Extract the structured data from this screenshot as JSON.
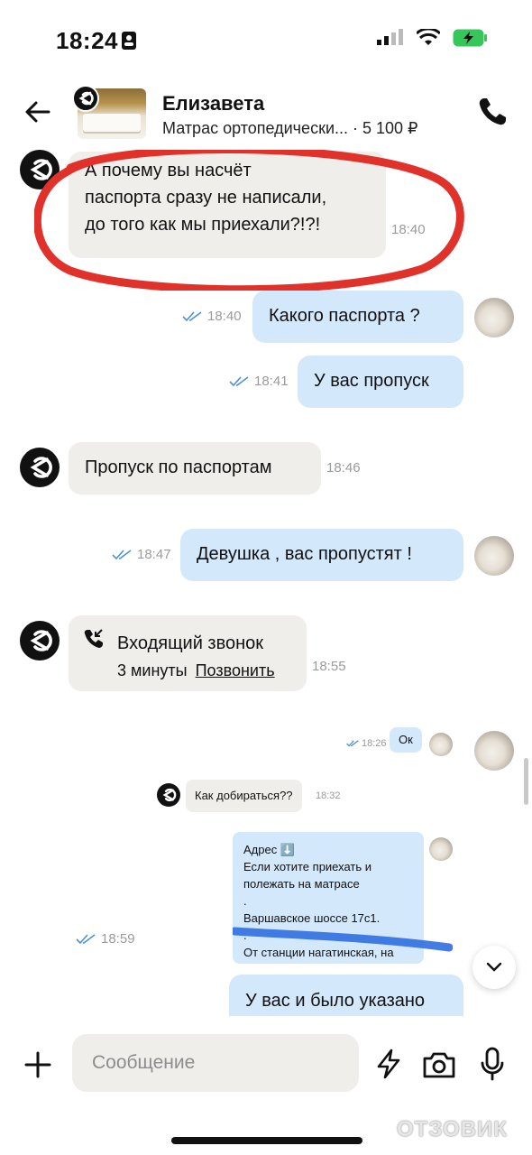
{
  "status_bar": {
    "time": "18:24"
  },
  "header": {
    "contact_name": "Елизавета",
    "listing_title": "Матрас ортопедически...",
    "price": "· 5 100 ₽"
  },
  "messages": [
    {
      "side": "in",
      "text_lines": [
        "А почему вы насчёт",
        "паспорта сразу не написали,",
        "до того как мы приехали?!?!"
      ],
      "time": "18:40"
    },
    {
      "side": "out",
      "text": "Какого паспорта ?",
      "time": "18:40"
    },
    {
      "side": "out",
      "text": "У вас пропуск",
      "time": "18:41"
    },
    {
      "side": "in",
      "text": "Пропуск по паспортам",
      "time": "18:46"
    },
    {
      "side": "out",
      "text": "Девушка , вас пропустят !",
      "time": "18:47"
    },
    {
      "side": "in",
      "type": "call",
      "title": "Входящий звонок",
      "duration": "3 минуты",
      "callback": "Позвонить",
      "time": "18:55"
    },
    {
      "side": "out",
      "type": "image",
      "time": "18:59",
      "image": {
        "ok_time": "18:26",
        "ok_text": "Ок",
        "question": "Как добираться??",
        "question_time": "18:32",
        "address_lines": [
          "Адрес ⬇️",
          "Если хотите приехать и",
          "полежать на матрасе",
          ".",
          "Варшавское шоссе 17с1.",
          ".",
          "От станции нагатинская, на"
        ]
      }
    },
    {
      "side": "out",
      "text": "У вас и было указано"
    }
  ],
  "composer": {
    "placeholder": "Сообщение"
  },
  "watermark": "ОТЗОВИК",
  "colors": {
    "incoming": "#f0eeeb",
    "outgoing": "#d3e8fb",
    "highlight": "#e0322a",
    "tick": "#4a90d9"
  }
}
